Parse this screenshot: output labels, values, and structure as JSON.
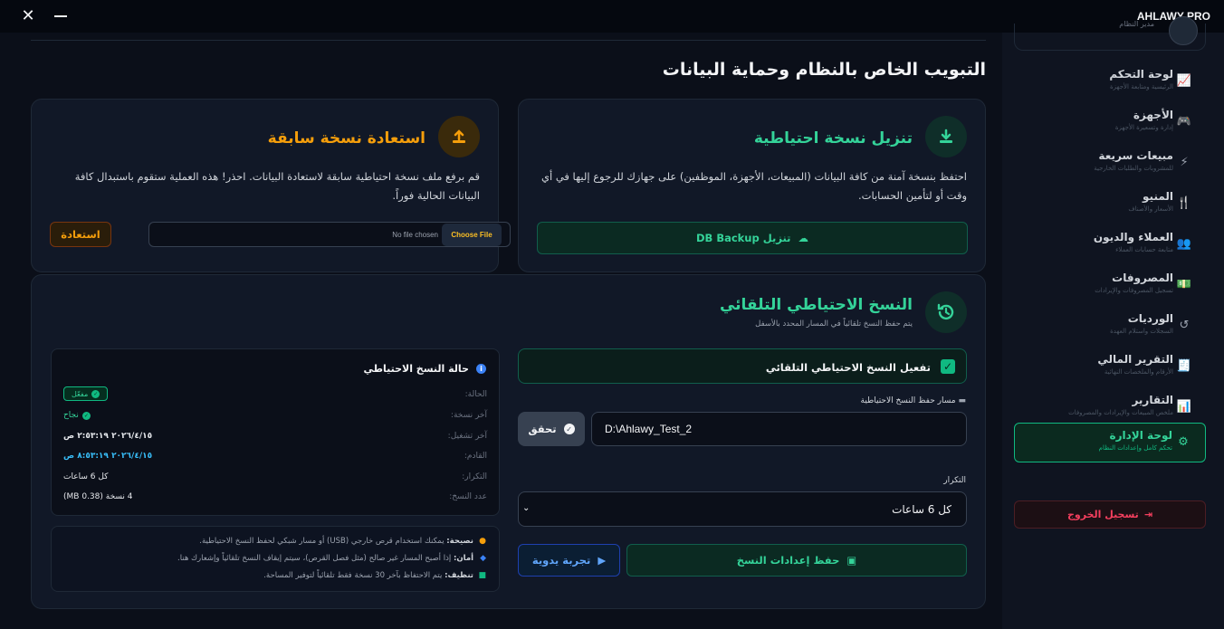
{
  "window": {
    "title": "AHLAWY PRO",
    "close": "✕"
  },
  "sidebar": {
    "role": "مدير النظام",
    "items": [
      {
        "label": "لوحة التحكم",
        "sub": "الرئيسية ومتابعة الأجهزة",
        "icon": "chart-line-icon",
        "glyph": "📈"
      },
      {
        "label": "الأجهزة",
        "sub": "إدارة وتسعيرة الأجهزة",
        "icon": "gamepad-icon",
        "glyph": "🎮"
      },
      {
        "label": "مبيعات سريعة",
        "sub": "للمشروبات والطلبات الخارجية",
        "icon": "bolt-icon",
        "glyph": "⚡"
      },
      {
        "label": "المنيو",
        "sub": "الأسعار والأصناف",
        "icon": "utensils-icon",
        "glyph": "🍴"
      },
      {
        "label": "العملاء والديون",
        "sub": "متابعة حسابات العملاء",
        "icon": "users-icon",
        "glyph": "👥"
      },
      {
        "label": "المصروفات",
        "sub": "تسجيل المصروفات والإيرادات",
        "icon": "money-icon",
        "glyph": "💵"
      },
      {
        "label": "الورديات",
        "sub": "السجلات واستلام العهدة",
        "icon": "history-icon",
        "glyph": "↺"
      },
      {
        "label": "التقرير المالي",
        "sub": "الأرقام والملخصات النهائية",
        "icon": "receipt-icon",
        "glyph": "🧾"
      },
      {
        "label": "التقارير",
        "sub": "ملخص المبيعات والإيرادات والمصروفات",
        "icon": "bar-chart-icon",
        "glyph": "📊"
      },
      {
        "label": "لوحة الإدارة",
        "sub": "تحكم كامل وإعدادات النظام",
        "icon": "users-cog-icon",
        "glyph": "⚙"
      }
    ],
    "logout": "تسجيل الخروج"
  },
  "main": {
    "title": "التبويب الخاص بالنظام وحماية البيانات",
    "download": {
      "title": "تنزيل نسخة احتياطية",
      "text": "احتفظ بنسخة آمنة من كافة البيانات (المبيعات، الأجهزة، الموظفين) على جهازك للرجوع إليها في أي وقت أو لتأمين الحسابات.",
      "button": "تنزيل DB Backup"
    },
    "restore": {
      "title": "استعادة نسخة سابقة",
      "text": "قم برفع ملف نسخة احتياطية سابقة لاستعادة البيانات. احذر! هذه العملية ستقوم باستبدال كافة البيانات الحالية فوراً.",
      "choose": "Choose File",
      "nofile": "No file chosen",
      "button": "استعادة"
    },
    "auto": {
      "title": "النسخ الاحتياطي التلقائي",
      "subtitle": "يتم حفظ النسخ تلقائياً في المسار المحدد بالأسفل",
      "enable_label": "تفعيل النسخ الاحتياطي التلقائي",
      "enabled": true,
      "path_label": "مسار حفظ النسخ الاحتياطية",
      "path_value": "D:\\Ahlawy_Test_2",
      "verify": "تحقق",
      "freq_label": "التكرار",
      "freq_value": "كل 6 ساعات",
      "save": "حفظ إعدادات النسخ",
      "manual": "تجربة يدوية"
    },
    "status": {
      "title": "حالة النسخ الاحتياطي",
      "state_label": "الحالة:",
      "state_value": "مفعّل",
      "last_label": "آخر نسخة:",
      "last_value": "نجاح",
      "lastrun_label": "آخر تشغيل:",
      "lastrun_value": "٢٠٢٦/٤/١٥ ٢:٥٣:١٩ ص",
      "next_label": "القادم:",
      "next_value": "٢٠٢٦/٤/١٥ ٨:٥٣:١٩ ص",
      "repeat_label": "التكرار:",
      "repeat_value": "كل 6 ساعات",
      "count_label": "عدد النسخ:",
      "count_value": "4 نسخة (0.38 MB)"
    },
    "tips": [
      {
        "key": "نصيحة:",
        "text": " يمكنك استخدام قرص خارجي (USB) أو مسار شبكي لحفظ النسخ الاحتياطية.",
        "icon": "lightbulb-icon",
        "color": "#f59e0b"
      },
      {
        "key": "أمان:",
        "text": " إذا أصبح المسار غير صالح (مثل فصل القرص)، سيتم إيقاف النسخ تلقائياً وإشعارك هنا.",
        "icon": "shield-icon",
        "color": "#3b82f6"
      },
      {
        "key": "تنظيف:",
        "text": " يتم الاحتفاظ بآخر 30 نسخة فقط تلقائياً لتوفير المساحة.",
        "icon": "database-icon",
        "color": "#10b981"
      }
    ]
  },
  "colors": {
    "accent_green": "#10b981",
    "accent_amber": "#f59e0b",
    "danger": "#f43f5e",
    "info": "#3b82f6"
  }
}
